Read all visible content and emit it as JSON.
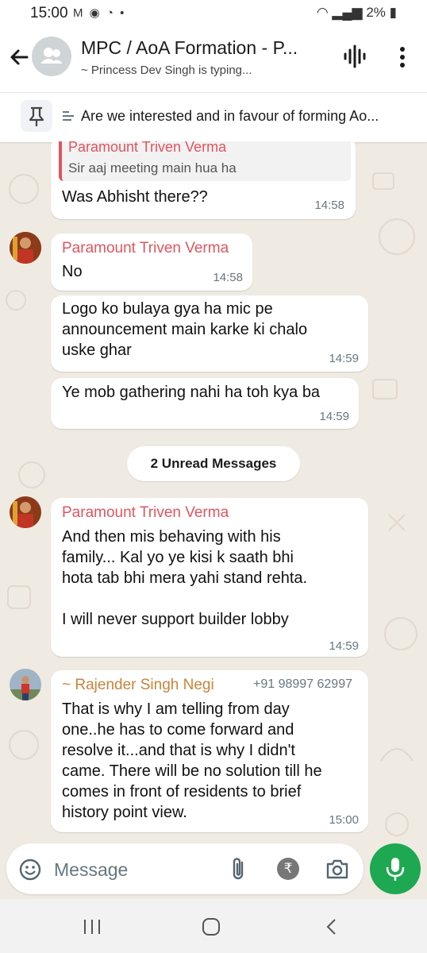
{
  "status_bar": {
    "time": "15:00",
    "left_icons": "M ◉ ◔ •",
    "battery": "2%"
  },
  "header": {
    "title": "MPC / AoA Formation - P...",
    "subtitle": "~ Princess Dev Singh is typing..."
  },
  "pinned": {
    "text": "Are we interested and in favour of forming Ao..."
  },
  "messages": [
    {
      "quote_sender": "Paramount Triven Verma",
      "quote_text": "Sir aaj meeting main hua ha",
      "text": "Was Abhisht there??",
      "time": "14:58"
    },
    {
      "sender": "Paramount Triven Verma",
      "text": "No",
      "time": "14:58"
    },
    {
      "lines": [
        "Logo ko bulaya gya ha mic pe",
        "announcement main karke ki chalo",
        "uske ghar"
      ],
      "time": "14:59"
    },
    {
      "text": "Ye mob gathering nahi ha toh kya ba",
      "time": "14:59"
    },
    {
      "sender": "Paramount Triven Verma",
      "lines": [
        "And then mis behaving with his",
        "family... Kal yo ye kisi k saath bhi",
        "hota tab bhi mera yahi stand rehta.",
        "",
        "I will never support builder lobby"
      ],
      "time": "14:59"
    },
    {
      "sender": "~ Rajender Singh Negi",
      "phone": "+91 98997 62997",
      "lines": [
        "That is why I am telling from day",
        "one..he has to come forward and",
        "resolve it...and that is why I didn't",
        "came. There will be no solution till he",
        "comes in front of residents to brief",
        "history point view."
      ],
      "time": "15:00"
    }
  ],
  "unread_label": "2 Unread Messages",
  "composer": {
    "placeholder": "Message"
  },
  "colors": {
    "sender_red": "#e0555f",
    "sender_orange": "#c8843a",
    "mic_green": "#1da851",
    "chat_bg": "#efeae2"
  },
  "icons": [
    "back-arrow-icon",
    "group-avatar-icon",
    "voice-wave-icon",
    "more-vert-icon",
    "pin-icon",
    "emoji-icon",
    "attach-icon",
    "rupee-icon",
    "camera-icon",
    "mic-icon",
    "recents-icon",
    "home-icon",
    "back-nav-icon"
  ]
}
